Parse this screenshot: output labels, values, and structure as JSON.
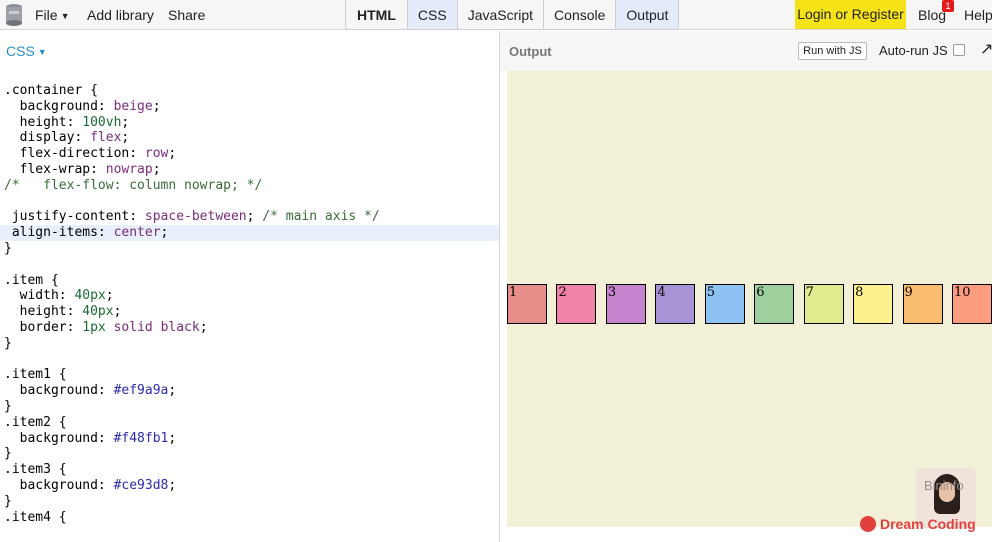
{
  "topbar": {
    "menu": [
      "File",
      "Add library",
      "Share"
    ],
    "tabs": [
      "HTML",
      "CSS",
      "JavaScript",
      "Console",
      "Output"
    ],
    "login": "Login or Register",
    "blog": "Blog",
    "blog_badge": "1",
    "help": "Help"
  },
  "editor": {
    "language": "CSS",
    "lines": [
      [
        {
          "t": ".container {",
          "c": "k"
        }
      ],
      [
        {
          "t": "  background: ",
          "c": "k"
        },
        {
          "t": "beige",
          "c": "v"
        },
        {
          "t": ";",
          "c": "k"
        }
      ],
      [
        {
          "t": "  height: ",
          "c": "k"
        },
        {
          "t": "100vh",
          "c": "n"
        },
        {
          "t": ";",
          "c": "k"
        }
      ],
      [
        {
          "t": "  display: ",
          "c": "k"
        },
        {
          "t": "flex",
          "c": "v"
        },
        {
          "t": ";",
          "c": "k"
        }
      ],
      [
        {
          "t": "  flex-direction: ",
          "c": "k"
        },
        {
          "t": "row",
          "c": "v"
        },
        {
          "t": ";",
          "c": "k"
        }
      ],
      [
        {
          "t": "  flex-wrap: ",
          "c": "k"
        },
        {
          "t": "nowrap",
          "c": "v"
        },
        {
          "t": ";",
          "c": "k"
        }
      ],
      [
        {
          "t": "/*   flex-flow: column nowrap; */",
          "c": "c"
        }
      ],
      [
        {
          "t": "",
          "c": "k"
        }
      ],
      [
        {
          "t": " justify-content: ",
          "c": "k"
        },
        {
          "t": "space-between",
          "c": "v"
        },
        {
          "t": "; ",
          "c": "k"
        },
        {
          "t": "/* main axis */",
          "c": "c"
        }
      ],
      [
        {
          "t": " align-items: ",
          "c": "k"
        },
        {
          "t": "center",
          "c": "v"
        },
        {
          "t": ";",
          "c": "k"
        }
      ],
      [
        {
          "t": "}",
          "c": "k"
        }
      ],
      [
        {
          "t": "",
          "c": "k"
        }
      ],
      [
        {
          "t": ".item {",
          "c": "k"
        }
      ],
      [
        {
          "t": "  width: ",
          "c": "k"
        },
        {
          "t": "40px",
          "c": "n"
        },
        {
          "t": ";",
          "c": "k"
        }
      ],
      [
        {
          "t": "  height: ",
          "c": "k"
        },
        {
          "t": "40px",
          "c": "n"
        },
        {
          "t": ";",
          "c": "k"
        }
      ],
      [
        {
          "t": "  border: ",
          "c": "k"
        },
        {
          "t": "1px",
          "c": "n"
        },
        {
          "t": " ",
          "c": "k"
        },
        {
          "t": "solid",
          "c": "v"
        },
        {
          "t": " ",
          "c": "k"
        },
        {
          "t": "black",
          "c": "v"
        },
        {
          "t": ";",
          "c": "k"
        }
      ],
      [
        {
          "t": "}",
          "c": "k"
        }
      ],
      [
        {
          "t": "",
          "c": "k"
        }
      ],
      [
        {
          "t": ".item1 {",
          "c": "k"
        }
      ],
      [
        {
          "t": "  background: ",
          "c": "k"
        },
        {
          "t": "#ef9a9a",
          "c": "h"
        },
        {
          "t": ";",
          "c": "k"
        }
      ],
      [
        {
          "t": "}",
          "c": "k"
        }
      ],
      [
        {
          "t": ".item2 {",
          "c": "k"
        }
      ],
      [
        {
          "t": "  background: ",
          "c": "k"
        },
        {
          "t": "#f48fb1",
          "c": "h"
        },
        {
          "t": ";",
          "c": "k"
        }
      ],
      [
        {
          "t": "}",
          "c": "k"
        }
      ],
      [
        {
          "t": ".item3 {",
          "c": "k"
        }
      ],
      [
        {
          "t": "  background: ",
          "c": "k"
        },
        {
          "t": "#ce93d8",
          "c": "h"
        },
        {
          "t": ";",
          "c": "k"
        }
      ],
      [
        {
          "t": "}",
          "c": "k"
        }
      ],
      [
        {
          "t": ".item4 {",
          "c": "k"
        }
      ]
    ],
    "highlighted_line": 9
  },
  "output": {
    "title": "Output",
    "run_button": "Run with JS",
    "autorun_label": "Auto-run JS",
    "items": [
      {
        "label": "1",
        "color": "#e88e8a"
      },
      {
        "label": "2",
        "color": "#f083a7"
      },
      {
        "label": "3",
        "color": "#c684cf"
      },
      {
        "label": "4",
        "color": "#a893d6"
      },
      {
        "label": "5",
        "color": "#8ec2f2"
      },
      {
        "label": "6",
        "color": "#9dd09c"
      },
      {
        "label": "7",
        "color": "#e2ea8f"
      },
      {
        "label": "8",
        "color": "#fbf18e"
      },
      {
        "label": "9",
        "color": "#fbbd6f"
      },
      {
        "label": "10",
        "color": "#fb9d7e"
      }
    ]
  },
  "overlay": {
    "watermark": "Dream Coding",
    "avatar_text": "Bininfo"
  }
}
